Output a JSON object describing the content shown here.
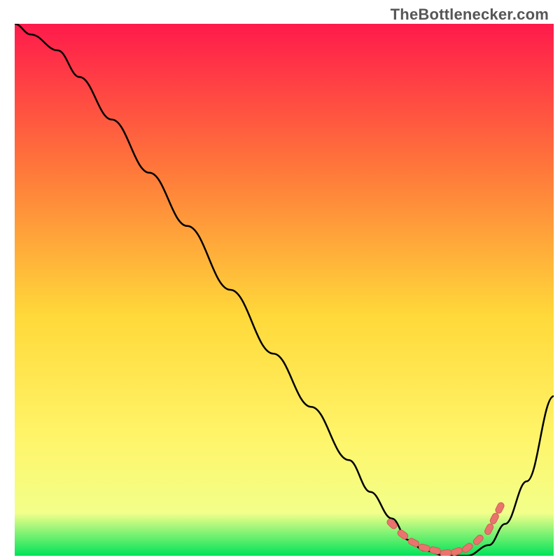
{
  "watermark": "TheBottlenecker.com",
  "colors": {
    "grad_top": "#ff1a4b",
    "grad_mid1": "#ff7a3a",
    "grad_mid2": "#ffd93a",
    "grad_low1": "#fff56a",
    "grad_low2": "#f2ff8a",
    "grad_bottom": "#00e35a",
    "line": "#000000",
    "dot_fill": "#e9746d",
    "dot_stroke": "#d35b55"
  },
  "chart_data": {
    "type": "line",
    "title": "",
    "xlabel": "",
    "ylabel": "",
    "xlim": [
      0,
      100
    ],
    "ylim": [
      0,
      100
    ],
    "series": [
      {
        "name": "bottleneck-curve",
        "x": [
          0,
          3,
          8,
          12,
          18,
          25,
          32,
          40,
          48,
          55,
          62,
          66,
          70,
          73,
          76,
          80,
          84,
          88,
          91,
          95,
          100
        ],
        "y": [
          100,
          98,
          95,
          90,
          82,
          72,
          62,
          50,
          38,
          28,
          18,
          12,
          7,
          3,
          1,
          0,
          0,
          2,
          6,
          14,
          30
        ]
      }
    ],
    "dots": {
      "name": "optimal-zone",
      "x": [
        70,
        72,
        74,
        76,
        78,
        80,
        82,
        84,
        86,
        88,
        89,
        90
      ],
      "y": [
        6,
        4,
        2.5,
        1.5,
        1,
        0.5,
        0.8,
        1.5,
        3,
        5,
        7,
        9
      ]
    }
  }
}
